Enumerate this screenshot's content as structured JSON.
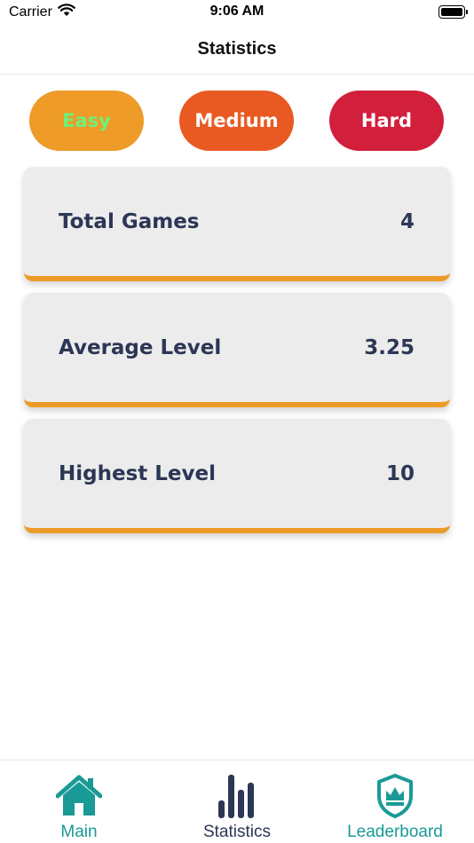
{
  "status_bar": {
    "carrier": "Carrier",
    "time": "9:06 AM"
  },
  "nav": {
    "title": "Statistics"
  },
  "difficulty": {
    "options": [
      "Easy",
      "Medium",
      "Hard"
    ],
    "selected": "Easy"
  },
  "stats": [
    {
      "label": "Total Games",
      "value": "4"
    },
    {
      "label": "Average Level",
      "value": "3.25"
    },
    {
      "label": "Highest Level",
      "value": "10"
    }
  ],
  "tabs": [
    {
      "label": "Main",
      "icon": "home-icon"
    },
    {
      "label": "Statistics",
      "icon": "bar-chart-icon"
    },
    {
      "label": "Leaderboard",
      "icon": "crown-shield-icon"
    }
  ],
  "colors": {
    "easy": "#ee9b28",
    "easy_text": "#6ff07a",
    "medium": "#e95a22",
    "hard": "#d21f3c",
    "card_bg": "#ececec",
    "card_accent": "#ec9b28",
    "text_dark": "#2c3655",
    "teal": "#1a9a96"
  }
}
